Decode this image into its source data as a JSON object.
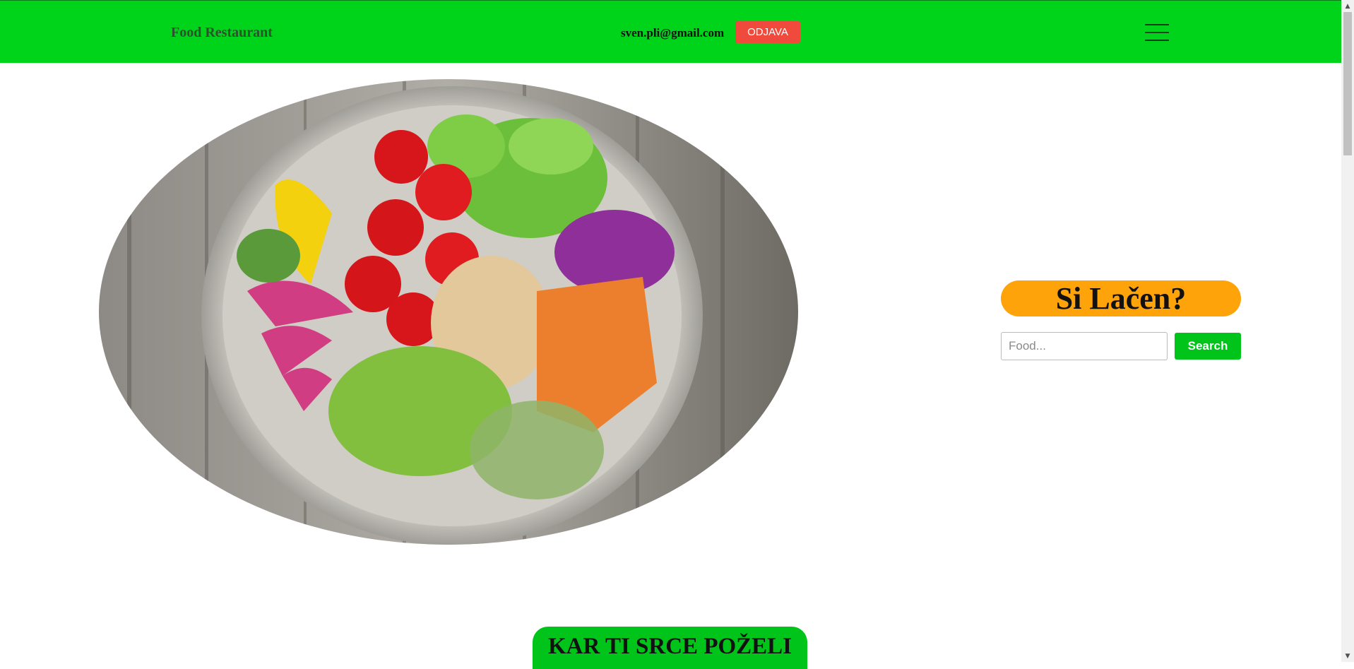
{
  "header": {
    "brand": "Food Restaurant",
    "user_email": "sven.pli@gmail.com",
    "logout_label": "ODJAVA",
    "menu_icon": "hamburger-menu-icon",
    "background_color": "#00d41a"
  },
  "hero": {
    "image": "salad-bowl-photo"
  },
  "search": {
    "title": "Si Lačen?",
    "placeholder": "Food...",
    "value": "",
    "button_label": "Search",
    "title_color": "#ffa30a",
    "button_color": "#00c41a"
  },
  "section": {
    "title": "KAR TI SRCE POŽELI"
  },
  "scrollbar": {
    "up_icon": "scroll-up-arrow-icon",
    "down_icon": "scroll-down-arrow-icon"
  }
}
